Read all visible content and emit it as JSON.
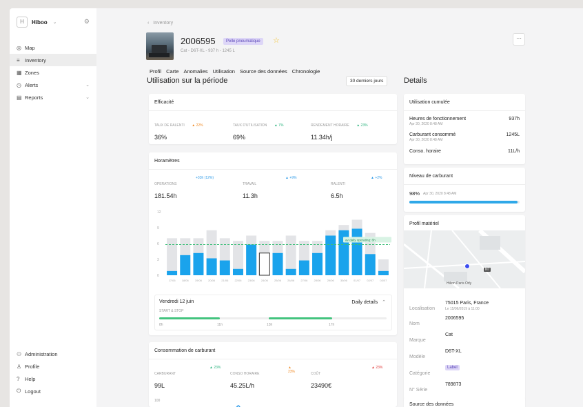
{
  "sidebar": {
    "brand": "Hiboo",
    "items": [
      {
        "label": "Map",
        "icon": "map-pin-icon"
      },
      {
        "label": "Inventory",
        "icon": "list-icon"
      },
      {
        "label": "Zones",
        "icon": "grid-icon"
      },
      {
        "label": "Alerts",
        "icon": "alert-icon"
      },
      {
        "label": "Reports",
        "icon": "report-icon"
      }
    ],
    "bottom_items": [
      {
        "label": "Administration",
        "icon": "admin-icon"
      },
      {
        "label": "Profile",
        "icon": "profile-icon"
      },
      {
        "label": "Help",
        "icon": "help-icon"
      },
      {
        "label": "Logout",
        "icon": "logout-icon"
      }
    ]
  },
  "header": {
    "breadcrumb": "Inventory",
    "asset_id": "2006595",
    "badge": "Pelle pneumatique",
    "subtitle": "Cat - D6T-XL - 937 h - 1245 L",
    "more": "···"
  },
  "tabs": [
    "Profil",
    "Carte",
    "Anomalies",
    "Utilisation",
    "Source des données",
    "Chronologie"
  ],
  "usage": {
    "title": "Utilisation sur la période",
    "period_button": "30 derniers jours",
    "efficacite": {
      "title": "Efficacité",
      "metrics": [
        {
          "label": "TAUX DE RALENTI",
          "delta": "▲ 22%",
          "value": "36%",
          "color": "#f08a24"
        },
        {
          "label": "TAUX D'UTILISATION",
          "delta": "▲ 7%",
          "value": "69%",
          "color": "#2bb37e"
        },
        {
          "label": "RENDEMENT HORAIRE",
          "delta": "▲ 23%",
          "value": "11.34h/j",
          "color": "#2bb37e"
        }
      ]
    },
    "horametres": {
      "title": "Horamètres",
      "metrics": [
        {
          "label": "OPERATIONS",
          "delta": "+33h (12%)",
          "value": "181.54h",
          "color": "#2f9be8"
        },
        {
          "label": "TRAVAIL",
          "delta": "▲ +9%",
          "value": "11.3h",
          "color": "#2f9be8"
        },
        {
          "label": "RALENTI",
          "delta": "▲ +2%",
          "value": "6.5h",
          "color": "#2f9be8"
        }
      ],
      "avg_label": "av daily operating: 6h",
      "day_title": "Vendredi 12 juin",
      "daily_details": "Daily details",
      "start_stop": "START & STOP",
      "ss_ticks": [
        "8h",
        "11h",
        "13h",
        "17h"
      ]
    },
    "carburant": {
      "title": "Consommation de carburant",
      "metrics": [
        {
          "label": "CARBURANT",
          "delta": "▲ 23%",
          "value": "99L",
          "color": "#2bb37e"
        },
        {
          "label": "CONSO HORAIRE",
          "delta": "▲ 23%",
          "value": "45.25L/h",
          "color": "#f08a24"
        },
        {
          "label": "COÛT",
          "delta": "▲ 23%",
          "value": "23490€",
          "color": "#e03c3c"
        }
      ],
      "ytick": "100"
    }
  },
  "details": {
    "title": "Details",
    "cumulee": {
      "title": "Utilisation cumulée",
      "rows": [
        {
          "label": "Heures de fonctionnement",
          "date": "Apr 30, 2020 8:48 AM",
          "value": "937h"
        },
        {
          "label": "Carburant consommé",
          "date": "Apr 30, 2020 8:48 AM",
          "value": "1245L"
        },
        {
          "label": "Conso. horaire",
          "date": "",
          "value": "11L/h"
        }
      ]
    },
    "niveau": {
      "title": "Niveau de carburant",
      "value": "98%",
      "date": "Apr 30, 2020 8:48 AM",
      "fraction": 0.98
    },
    "profil": {
      "title": "Profil matériel",
      "map_place": "Hilton Paris Orly",
      "map_road": "N7",
      "rows": [
        {
          "label": "Localisation",
          "value": "75015 Paris, France",
          "sub": "Le 15/06/2019 à 11:00"
        },
        {
          "label": "Nom",
          "value": "2006595",
          "sub": ""
        },
        {
          "label": "Marque",
          "value": "Cat",
          "sub": ""
        },
        {
          "label": "Modèle",
          "value": "D6T-XL",
          "sub": ""
        },
        {
          "label": "Catégorie",
          "value": "Label",
          "sub": ""
        },
        {
          "label": "N° Série",
          "value": "789873",
          "sub": ""
        }
      ]
    },
    "source_title": "Source des données"
  },
  "chart_data": {
    "type": "bar",
    "categories": [
      "17/06",
      "18/06",
      "19/06",
      "20/06",
      "21/06",
      "22/06",
      "23/06",
      "24/06",
      "25/06",
      "26/06",
      "27/06",
      "28/06",
      "29/06",
      "30/06",
      "01/07",
      "02/07",
      "03/07"
    ],
    "yticks": [
      "12",
      "9",
      "6",
      "3",
      "0"
    ],
    "ylim": [
      0,
      12
    ],
    "series": [
      {
        "name": "total",
        "values": [
          7,
          7,
          7,
          8.5,
          7,
          6.5,
          7.5,
          6.5,
          6.5,
          7.5,
          6.5,
          6.5,
          8.5,
          9.5,
          10.5,
          8,
          3
        ]
      },
      {
        "name": "operating",
        "values": [
          0.8,
          3.8,
          4.2,
          3.2,
          2.8,
          1.2,
          5.8,
          4.2,
          4.2,
          1.2,
          2.8,
          4.2,
          7.5,
          8.5,
          8.8,
          4,
          0.8
        ]
      }
    ],
    "selected_index": 7,
    "average": 5.8
  }
}
